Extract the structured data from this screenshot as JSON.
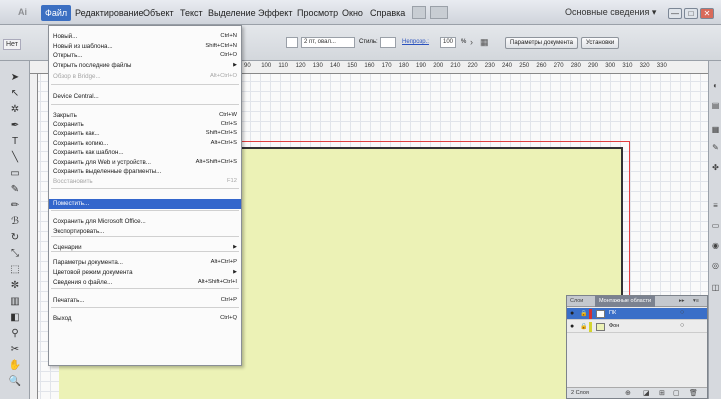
{
  "menubar": {
    "logo": "Ai",
    "items": [
      "Файл",
      "Редактирование",
      "Объект",
      "Текст",
      "Выделение",
      "Эффект",
      "Просмотр",
      "Окно",
      "Справка"
    ],
    "workspace": "Основные сведения ▾",
    "window_controls": [
      "—",
      "□",
      "✕"
    ]
  },
  "controlbar": {
    "left_label": "Нет",
    "stroke_select": "2 пт, овал...",
    "style_label": "Стиль:",
    "opacity_label": "Непрозр.:",
    "opacity_value": "100",
    "opacity_unit": "%",
    "doc_settings_button": "Параметры документа",
    "preferences_button": "Установки"
  },
  "ruler": {
    "ticks": [
      "90",
      "100",
      "110",
      "120",
      "130",
      "140",
      "150",
      "160",
      "170",
      "180",
      "190",
      "200",
      "210",
      "220",
      "230",
      "240",
      "250",
      "260",
      "270",
      "280",
      "290",
      "300",
      "310",
      "320",
      "330"
    ]
  },
  "file_menu": {
    "items": [
      {
        "label": "Новый...",
        "shortcut": "Ctrl+N"
      },
      {
        "label": "Новый из шаблона...",
        "shortcut": "Shift+Ctrl+N"
      },
      {
        "label": "Открыть...",
        "shortcut": "Ctrl+O"
      },
      {
        "label": "Открыть последние файлы",
        "shortcut": "",
        "submenu": true
      },
      {
        "label": "Обзор в Bridge...",
        "shortcut": "Alt+Ctrl+O",
        "disabled": true
      },
      {
        "label": "Device Central...",
        "shortcut": ""
      },
      {
        "label": "Закрыть",
        "shortcut": "Ctrl+W"
      },
      {
        "label": "Сохранить",
        "shortcut": "Ctrl+S"
      },
      {
        "label": "Сохранить как...",
        "shortcut": "Shift+Ctrl+S"
      },
      {
        "label": "Сохранить копию...",
        "shortcut": "Alt+Ctrl+S"
      },
      {
        "label": "Сохранить как шаблон...",
        "shortcut": ""
      },
      {
        "label": "Сохранить для Web и устройств...",
        "shortcut": "Alt+Shift+Ctrl+S"
      },
      {
        "label": "Сохранить выделенные фрагменты...",
        "shortcut": ""
      },
      {
        "label": "Восстановить",
        "shortcut": "F12",
        "disabled": true
      },
      {
        "label": "Поместить...",
        "shortcut": "",
        "highlighted": true
      },
      {
        "label": "Сохранить для Microsoft Office...",
        "shortcut": ""
      },
      {
        "label": "Экспортировать...",
        "shortcut": ""
      },
      {
        "label": "Сценарии",
        "shortcut": "",
        "submenu": true
      },
      {
        "label": "Параметры документа...",
        "shortcut": "Alt+Ctrl+P"
      },
      {
        "label": "Цветовой режим документа",
        "shortcut": "",
        "submenu": true
      },
      {
        "label": "Сведения о файле...",
        "shortcut": "Alt+Shift+Ctrl+I"
      },
      {
        "label": "Печатать...",
        "shortcut": "Ctrl+P"
      },
      {
        "label": "Выход",
        "shortcut": "Ctrl+Q"
      }
    ]
  },
  "layers_panel": {
    "tabs": [
      "Слои",
      "Монтажные области",
      "▸▸",
      "▾≡"
    ],
    "active_tab": "Монтажные области",
    "layers": [
      {
        "name": "ПК",
        "color": "#d43030",
        "selected": true
      },
      {
        "name": "Фон",
        "color": "#d4d430",
        "selected": false
      }
    ],
    "count": "2 Слоя"
  },
  "colors": {
    "artboard": "#ecf2b6",
    "bleed_guide": "#e04040",
    "menu_highlight": "#3366cc"
  }
}
